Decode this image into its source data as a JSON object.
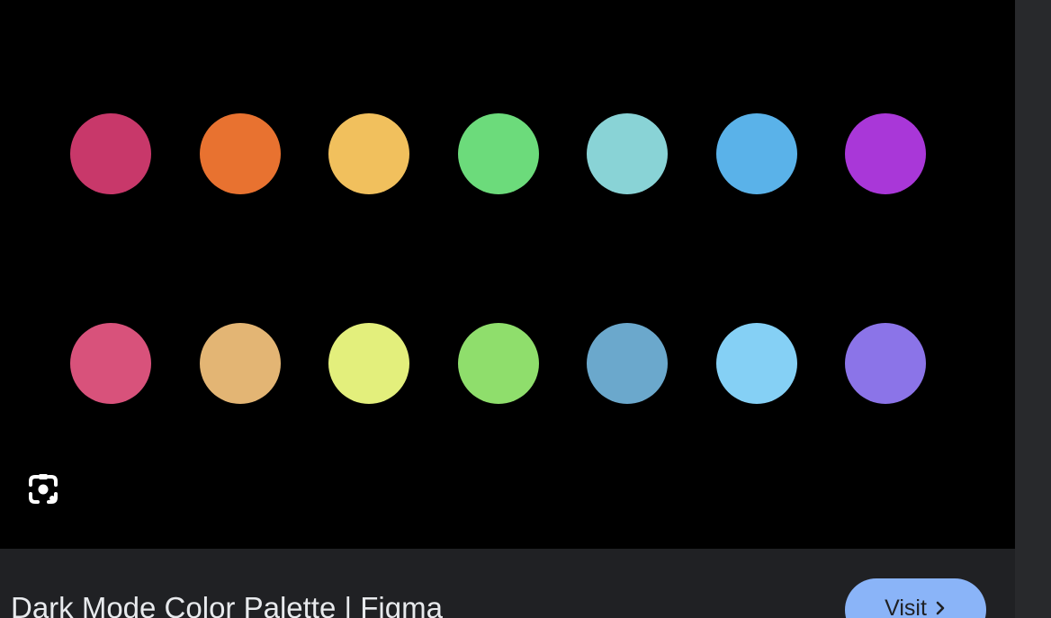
{
  "result": {
    "title": "Dark Mode Color Palette | Figma",
    "visit_label": "Visit"
  },
  "palette": {
    "row1": [
      "#c8386a",
      "#e87230",
      "#f1c05d",
      "#6cdb7b",
      "#89d3d6",
      "#5ab2e9",
      "#a937d8"
    ],
    "row2": [
      "#d8527b",
      "#e3b574",
      "#e3ef7c",
      "#8fde6c",
      "#6ba8cc",
      "#85d0f5",
      "#8b74e8"
    ]
  },
  "icons": {
    "lens": "google-lens-icon",
    "visit_chevron": "chevron-right-icon"
  },
  "colors": {
    "background": "#000000",
    "footer": "#202124",
    "title_text": "#e8eaed",
    "visit_button": "#8ab4f8"
  }
}
